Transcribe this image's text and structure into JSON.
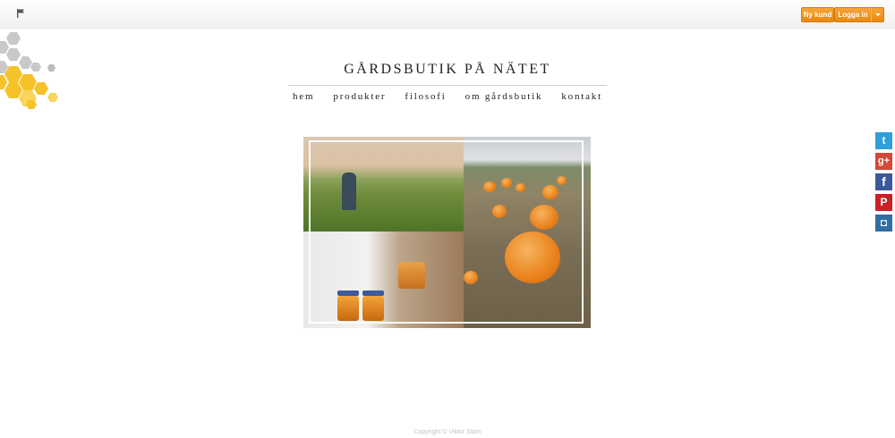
{
  "topbar": {
    "new_customer_label": "Ny kund",
    "login_label": "Logga in"
  },
  "site": {
    "title": "GÅRDSBUTIK PÅ NÄTET"
  },
  "nav": {
    "items": [
      "hem",
      "produkter",
      "filosofi",
      "om gårdsbutik",
      "kontakt"
    ]
  },
  "social": {
    "twitter": "t",
    "googleplus": "g+",
    "facebook": "f",
    "pinterest": "P",
    "instagram": "◘"
  },
  "colors": {
    "accent_orange": "#f19a2a",
    "hex_yellow": "#f5c22a",
    "hex_grey": "#c9c9c9"
  },
  "footer": {
    "copyright": "Copyright © Viktor Stam"
  }
}
